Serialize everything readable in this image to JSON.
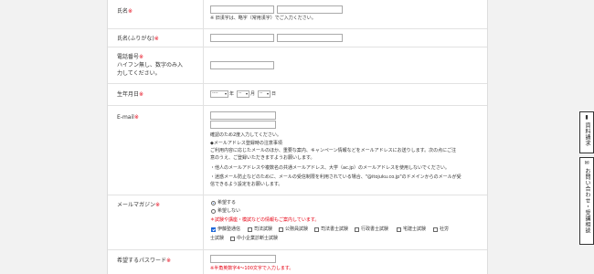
{
  "required_mark": "※",
  "fields": {
    "name": {
      "label": "氏名",
      "note": "※ 旧漢字は、略字（常用漢字）でご入力ください。"
    },
    "kana": {
      "label": "氏名(ふりがな)"
    },
    "phone": {
      "label_line1": "電話番号",
      "label_line2": "ハイフン無し、数字のみ入",
      "label_line3": "力してください。"
    },
    "birthday": {
      "label": "生年月日",
      "year_value": "----",
      "year_unit": "年",
      "month_value": "--",
      "month_unit": "月",
      "day_value": "--",
      "day_unit": "日"
    },
    "email": {
      "label": "E-mail",
      "confirm_note": "確認のため2度入力してください。",
      "notice_heading": "◆メールアドレス登録時の注意事項",
      "notice_lines": [
        "ご利用内容に応じたメールのほか、重要な案内、キャンペーン情報などをメールアドレスにお送りします。次の点にご注",
        "意のうえ、ご登録いただきますようお願いします。",
        "・他人のメールアドレスや複数名の共通メールアドレス、大学（ac.jp）のメールアドレスを使用しないでください。",
        "・迷惑メール防止などのために、メールの受信制限を利用されている場合、\"@itojuku.co.jp\"のドメインからのメールが受",
        "信できるよう設定をお願いします。"
      ]
    },
    "magazine": {
      "label": "メールマガジン",
      "option_yes": "希望する",
      "option_no": "希望しない",
      "promo": "＊試験や講座・模試などの情報もご案内しています。",
      "checkboxes": [
        "伊藤塾通信",
        "司法試験",
        "公務員試験",
        "司法書士試験",
        "行政書士試験",
        "宅建士試験",
        "社労",
        "士試験",
        "中小企業診断士試験"
      ]
    },
    "password": {
      "label": "希望するパスワード",
      "note": "※半角英数字4〜100文字で入力します。"
    }
  },
  "sidebar": {
    "brochure": {
      "icon": "document-icon",
      "label": "資料請求"
    },
    "inquiry": {
      "icon": "envelope-icon",
      "label": "お問い合わせ・受講相談"
    }
  }
}
